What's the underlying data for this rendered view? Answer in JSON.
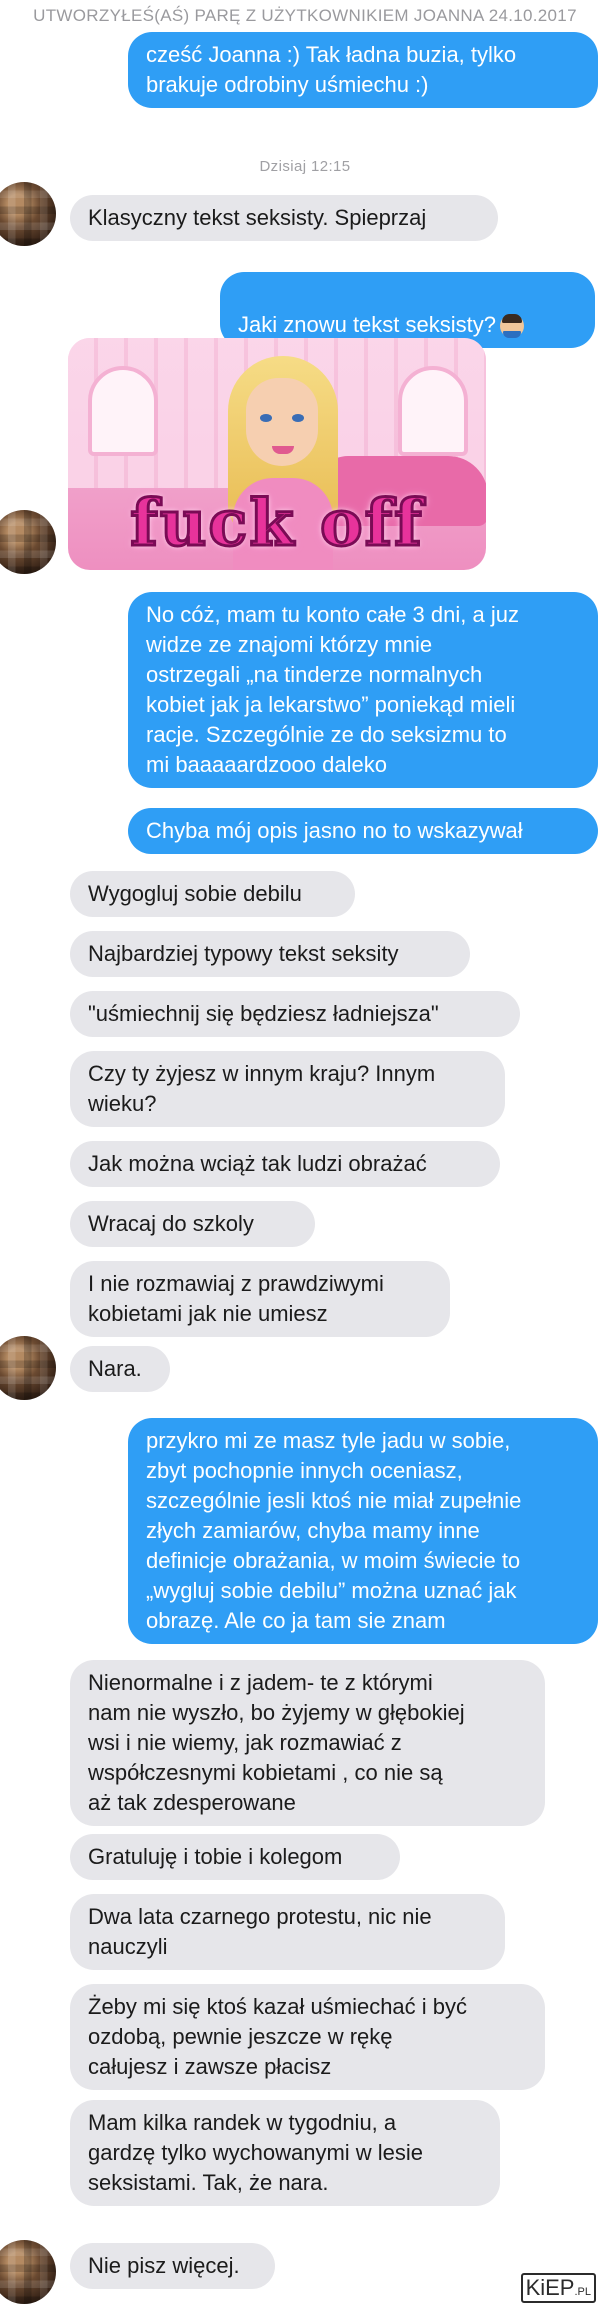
{
  "header": {
    "match_text": "UTWORZYŁEŚ(AŚ) PARĘ Z UŻYTKOWNIKIEM JOANNA 24.10.2017",
    "day_separator": "Dzisiaj 12:15"
  },
  "gif": {
    "icon": "barbie-gif",
    "caption": "fuck off"
  },
  "messages": {
    "m1": "cześć Joanna :) Tak ładna buzia, tylko\nbrakuje odrobiny uśmiechu :)",
    "m2": "Klasyczny tekst seksisty. Spieprzaj",
    "m3": "Jaki znowu tekst seksisty?",
    "m4": "No cóż, mam tu konto całe 3 dni, a juz\nwidze ze znajomi którzy mnie\nostrzegali „na tinderze normalnych\nkobiet jak ja lekarstwo” poniekąd mieli\nracje. Szczególnie ze do seksizmu to\nmi baaaaardzooo daleko",
    "m5": "Chyba mój opis jasno no to wskazywał",
    "m6": "Wygogluj sobie debilu",
    "m7": "Najbardziej typowy tekst seksity",
    "m8": "\"uśmiechnij się będziesz ładniejsza\"",
    "m9": "Czy ty żyjesz w innym kraju? Innym\nwieku?",
    "m10": "Jak można wciąż tak ludzi obrażać",
    "m11": "Wracaj do szkoly",
    "m12": "I nie rozmawiaj z prawdziwymi\nkobietami jak nie umiesz",
    "m13": "Nara.",
    "m14": "przykro mi ze masz tyle jadu w sobie,\nzbyt pochopnie innych oceniasz,\nszczególnie jesli ktoś nie miał zupełnie\nzłych zamiarów, chyba mamy inne\ndefinicje obrażania, w moim świecie to\n„wygluj sobie debilu” można uznać jak\nobrazę. Ale co ja tam sie znam",
    "m15": "Nienormalne i z jadem- te z którymi\nnam nie wyszło, bo żyjemy w głębokiej\nwsi i nie wiemy, jak rozmawiać z\nwspółczesnymi  kobietami , co nie są\naż tak zdesperowane",
    "m16": "Gratuluję i tobie i kolegom",
    "m17": "Dwa lata czarnego protestu, nic nie\nnauczyli",
    "m18": "Żeby mi się ktoś kazał uśmiechać i być\nozdobą, pewnie jeszcze w rękę\ncałujesz i zawsze płacisz",
    "m19": "Mam kilka randek w tygodniu, a\ngardzę tylko wychowanymi w lesie\nseksistami. Tak, że nara.",
    "m20": "Nie pisz więcej."
  },
  "watermark": {
    "brand": "KiEP",
    "suffix": ".PL"
  },
  "colors": {
    "outgoing_bubble": "#2f9ef5",
    "incoming_bubble": "#e6e6ea"
  }
}
